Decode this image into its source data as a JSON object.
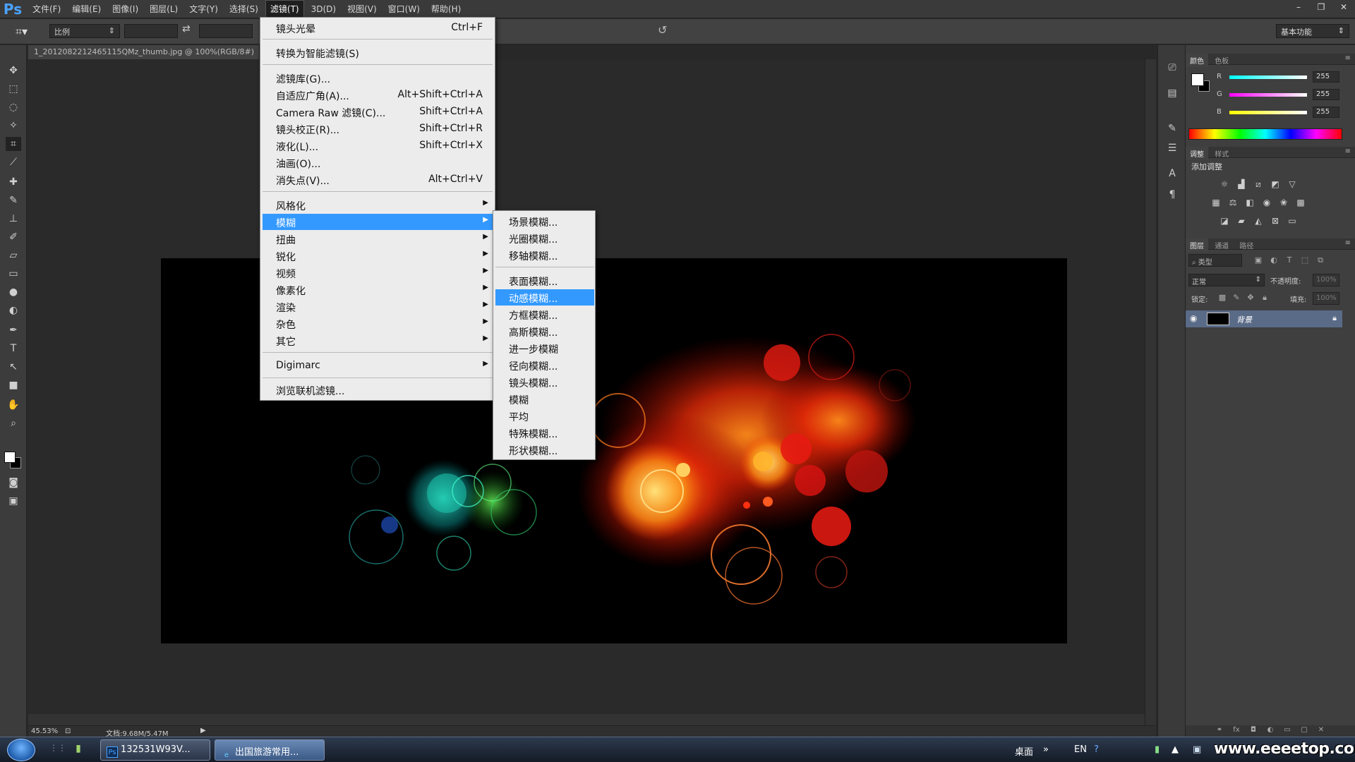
{
  "app": {
    "logo": "Ps"
  },
  "menubar": {
    "items": [
      "文件(F)",
      "编辑(E)",
      "图像(I)",
      "图层(L)",
      "文字(Y)",
      "选择(S)",
      "滤镜(T)",
      "3D(D)",
      "视图(V)",
      "窗口(W)",
      "帮助(H)"
    ],
    "active_index": 6
  },
  "window_controls": {
    "minimize": "–",
    "restore": "❐",
    "close": "✕"
  },
  "options_bar": {
    "ratio": "比例",
    "workspace": "基本功能"
  },
  "document": {
    "tab_title": "1_2012082212465115QMz_thumb.jpg @ 100%(RGB/8#)"
  },
  "status": {
    "zoom": "45.53%",
    "doc_info": "文档:9.68M/5.47M"
  },
  "panels": {
    "color_tabs": [
      "颜色",
      "色板"
    ],
    "rgb": [
      {
        "label": "R",
        "value": "255",
        "color": "#ff3b3b"
      },
      {
        "label": "G",
        "value": "255",
        "color": "#3bff5c"
      },
      {
        "label": "B",
        "value": "255",
        "color": "#3b6bff"
      }
    ],
    "adjust_tabs": [
      "调整",
      "样式"
    ],
    "adjust_title": "添加调整",
    "layer_tabs": [
      "图层",
      "通道",
      "路径"
    ],
    "layer_search": "类型",
    "blend_mode": "正常",
    "opacity_label": "不透明度:",
    "opacity_value": "100%",
    "lock_label": "锁定:",
    "fill_label": "填充:",
    "fill_value": "100%",
    "layer_name": "背景"
  },
  "filter_menu": {
    "items": [
      {
        "label": "镜头光晕",
        "shortcut": "Ctrl+F"
      },
      {
        "label": "转换为智能滤镜(S)",
        "shortcut": ""
      },
      {
        "label": "滤镜库(G)...",
        "shortcut": ""
      },
      {
        "label": "自适应广角(A)...",
        "shortcut": "Alt+Shift+Ctrl+A"
      },
      {
        "label": "Camera Raw 滤镜(C)...",
        "shortcut": "Shift+Ctrl+A"
      },
      {
        "label": "镜头校正(R)...",
        "shortcut": "Shift+Ctrl+R"
      },
      {
        "label": "液化(L)...",
        "shortcut": "Shift+Ctrl+X"
      },
      {
        "label": "油画(O)...",
        "shortcut": ""
      },
      {
        "label": "消失点(V)...",
        "shortcut": "Alt+Ctrl+V"
      },
      {
        "label": "风格化",
        "shortcut": ""
      },
      {
        "label": "模糊",
        "shortcut": ""
      },
      {
        "label": "扭曲",
        "shortcut": ""
      },
      {
        "label": "锐化",
        "shortcut": ""
      },
      {
        "label": "视频",
        "shortcut": ""
      },
      {
        "label": "像素化",
        "shortcut": ""
      },
      {
        "label": "渲染",
        "shortcut": ""
      },
      {
        "label": "杂色",
        "shortcut": ""
      },
      {
        "label": "其它",
        "shortcut": ""
      },
      {
        "label": "Digimarc",
        "shortcut": ""
      },
      {
        "label": "浏览联机滤镜...",
        "shortcut": ""
      }
    ],
    "highlighted_index": 10
  },
  "blur_submenu": {
    "items": [
      "场景模糊...",
      "光圈模糊...",
      "移轴模糊...",
      "表面模糊...",
      "动感模糊...",
      "方框模糊...",
      "高斯模糊...",
      "进一步模糊",
      "径向模糊...",
      "镜头模糊...",
      "模糊",
      "平均",
      "特殊模糊...",
      "形状模糊..."
    ],
    "highlighted_index": 4
  },
  "taskbar": {
    "tasks": [
      {
        "label": "132531W93V...",
        "active": false
      },
      {
        "label": "出国旅游常用...",
        "active": true
      }
    ],
    "tray": {
      "desktop": "桌面",
      "lang": "EN"
    },
    "watermark": "www.eeeetop.com"
  },
  "colors": {
    "accent": "#3399ff",
    "menu_bg": "#ececec",
    "ui_bg": "#282828"
  }
}
